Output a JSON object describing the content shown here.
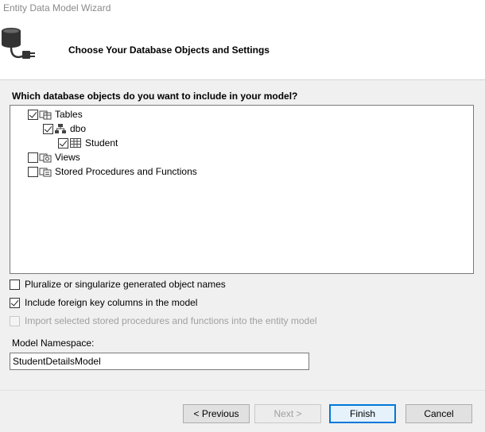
{
  "window": {
    "title": "Entity Data Model Wizard"
  },
  "header": {
    "heading": "Choose Your Database Objects and Settings",
    "icon": "database-plug-icon"
  },
  "objects": {
    "question": "Which database objects do you want to include in your model?",
    "tree": {
      "tables": {
        "label": "Tables",
        "checked": true
      },
      "dbo": {
        "label": "dbo",
        "checked": true
      },
      "student": {
        "label": "Student",
        "checked": true
      },
      "views": {
        "label": "Views",
        "checked": false
      },
      "procs": {
        "label": "Stored Procedures and Functions",
        "checked": false
      }
    }
  },
  "options": {
    "pluralize": {
      "label": "Pluralize or singularize generated object names",
      "checked": false
    },
    "foreign_keys": {
      "label": "Include foreign key columns in the model",
      "checked": true
    },
    "import_procs": {
      "label": "Import selected stored procedures and functions into the entity model",
      "checked": false,
      "disabled": true
    }
  },
  "namespace": {
    "label": "Model Namespace:",
    "value": "StudentDetailsModel"
  },
  "buttons": {
    "previous": "< Previous",
    "next": "Next >",
    "finish": "Finish",
    "cancel": "Cancel"
  }
}
